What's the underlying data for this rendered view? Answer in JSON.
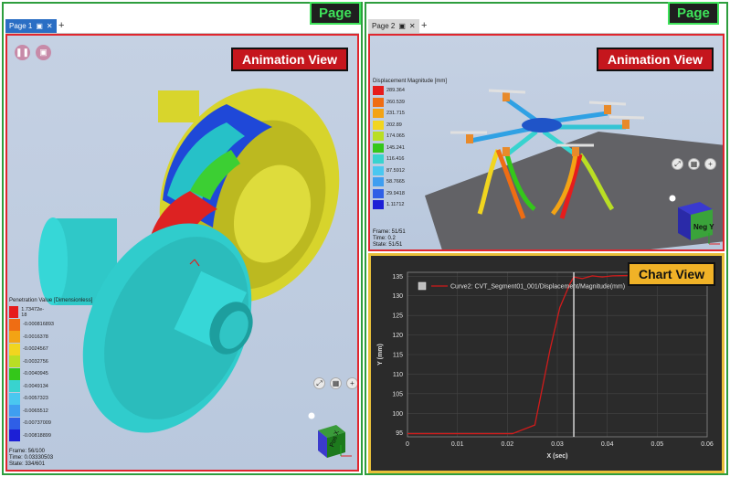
{
  "page1": {
    "badge": "Page",
    "tab_label": "Page 1",
    "view_label": "Animation  View",
    "legend": {
      "title": "Penetration Value [Dimensionless]",
      "values": [
        "1.73472e-18",
        "-0.000816893",
        "-0.0016378",
        "-0.0024567",
        "-0.0032756",
        "-0.0040945",
        "-0.0049134",
        "-0.0057323",
        "-0.0065512",
        "-0.00737009",
        "-0.00818899"
      ],
      "colors": [
        "#e61c1c",
        "#ef6d13",
        "#f3a314",
        "#f1d51f",
        "#b9de24",
        "#34c71a",
        "#38d3cf",
        "#4ac7f0",
        "#3f9ef0",
        "#2f5fe6",
        "#1c1fd6"
      ]
    },
    "info": {
      "frame": "Frame: 56/100",
      "time": "Time: 0.03330503",
      "state": "State: 334/601"
    },
    "cube_label": "Pos X"
  },
  "page2": {
    "badge": "Page",
    "tab_label": "Page 2",
    "view_label": "Animation  View",
    "legend": {
      "title": "Displacement Magnitude [mm]",
      "values": [
        "289.364",
        "260.539",
        "231.715",
        "202.89",
        "174.065",
        "145.241",
        "116.416",
        "87.5912",
        "58.7665",
        "29.9418",
        "1.11712"
      ],
      "colors": [
        "#e61c1c",
        "#ef6d13",
        "#f3a314",
        "#f1d51f",
        "#b9de24",
        "#34c71a",
        "#38d3cf",
        "#4ac7f0",
        "#3f9ef0",
        "#2f5fe6",
        "#1c1fd6"
      ]
    },
    "info": {
      "frame": "Frame: 51/51",
      "time": "Time: 0.2",
      "state": "State: 51/51"
    },
    "cube_label": "Neg Y"
  },
  "chart_view_label": "Chart  View",
  "chart_data": {
    "type": "line",
    "title": "",
    "xlabel": "X (sec)",
    "ylabel": "Y (mm)",
    "xlim": [
      0,
      0.06
    ],
    "ylim": [
      94,
      136
    ],
    "xticks": [
      "0",
      "0.01",
      "0.02",
      "0.03",
      "0.04",
      "0.05",
      "0.06"
    ],
    "yticks": [
      "95",
      "100",
      "105",
      "110",
      "115",
      "120",
      "125",
      "130",
      "135"
    ],
    "legend_placement": "top-left",
    "cursor_x": 0.0333,
    "series": [
      {
        "name": "Curve2: CVT_Segment01_001/Displacement/Magnitude(mm)",
        "color": "#d11b1b",
        "x": [
          0,
          0.021,
          0.0255,
          0.0285,
          0.0305,
          0.0325,
          0.0333,
          0.035,
          0.037,
          0.039,
          0.041,
          0.045
        ],
        "y": [
          94.8,
          94.8,
          97,
          116,
          127,
          133,
          134.8,
          134.4,
          135.1,
          134.8,
          135.1,
          135.2
        ]
      }
    ]
  }
}
